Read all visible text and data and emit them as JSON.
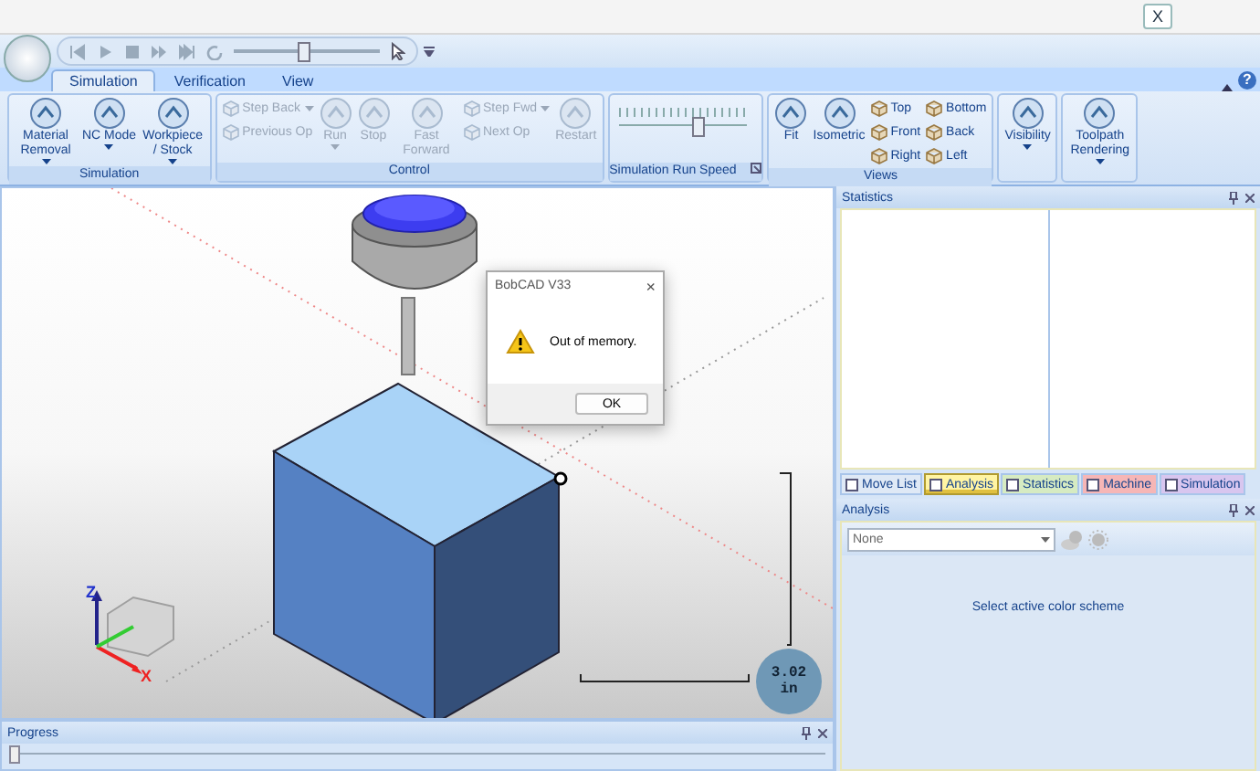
{
  "close_button": "X",
  "quick_access": {
    "speed": {
      "level": 0.48
    }
  },
  "ribbon": {
    "help_button": "?",
    "tabs": [
      {
        "label": "Simulation",
        "selected": true
      },
      {
        "label": "Verification",
        "selected": false
      },
      {
        "label": "View",
        "selected": false
      }
    ],
    "groups": [
      {
        "title": "Simulation",
        "items": [
          {
            "label": "Material Removal",
            "kind": "large",
            "dropdown": true,
            "disabled": false
          },
          {
            "label": "NC Mode",
            "kind": "large",
            "dropdown": true,
            "disabled": false
          },
          {
            "label": "Workpiece / Stock",
            "kind": "large",
            "dropdown": true,
            "disabled": false
          }
        ]
      },
      {
        "title": "Control",
        "items": [
          {
            "label": "Step Back",
            "kind": "small",
            "dropdown": true,
            "disabled": true
          },
          {
            "label": "Previous Op",
            "kind": "small",
            "dropdown": false,
            "disabled": true
          },
          {
            "label": "Run",
            "kind": "large",
            "dropdown": true,
            "disabled": true
          },
          {
            "label": "Stop",
            "kind": "large",
            "dropdown": false,
            "disabled": true
          },
          {
            "label": "Fast Forward",
            "kind": "large",
            "dropdown": false,
            "disabled": true
          },
          {
            "label": "Step Fwd",
            "kind": "small",
            "dropdown": true,
            "disabled": true
          },
          {
            "label": "Next Op",
            "kind": "small",
            "dropdown": false,
            "disabled": true
          },
          {
            "label": "Restart",
            "kind": "large",
            "dropdown": false,
            "disabled": true
          }
        ]
      },
      {
        "title": "Simulation Run Speed",
        "items": [
          {
            "kind": "slider",
            "level": 0.62
          }
        ]
      },
      {
        "title": "Views",
        "items": [
          {
            "label": "Fit",
            "kind": "large",
            "dropdown": false,
            "disabled": false
          },
          {
            "label": "Isometric",
            "kind": "large",
            "dropdown": false,
            "disabled": false
          },
          {
            "label": "Top",
            "kind": "small",
            "dropdown": false,
            "disabled": false
          },
          {
            "label": "Front",
            "kind": "small",
            "dropdown": false,
            "disabled": false
          },
          {
            "label": "Right",
            "kind": "small",
            "dropdown": false,
            "disabled": false
          },
          {
            "label": "Bottom",
            "kind": "small",
            "dropdown": false,
            "disabled": false
          },
          {
            "label": "Back",
            "kind": "small",
            "dropdown": false,
            "disabled": false
          },
          {
            "label": "Left",
            "kind": "small",
            "dropdown": false,
            "disabled": false
          }
        ]
      },
      {
        "items": [
          {
            "label": "Visibility",
            "kind": "large",
            "dropdown": true,
            "disabled": false
          }
        ]
      },
      {
        "items": [
          {
            "label": "Toolpath Rendering",
            "kind": "large",
            "dropdown": true,
            "disabled": false
          }
        ]
      }
    ]
  },
  "viewport": {
    "axes": {
      "z": "Z",
      "x": "X"
    },
    "scale": {
      "value": "3.02",
      "unit": "in"
    },
    "dialog": {
      "title": "BobCAD V33",
      "close": "×",
      "message": "Out of memory.",
      "button": "OK"
    }
  },
  "progress": {
    "title": "Progress",
    "level": 0
  },
  "statistics": {
    "title": "Statistics"
  },
  "dock_tabs": [
    {
      "label": "Move List",
      "color": "#dfe9f6",
      "selected": false
    },
    {
      "label": "Analysis",
      "color": "#fff4a3",
      "selected": true
    },
    {
      "label": "Statistics",
      "color": "#d6ebc2",
      "selected": false
    },
    {
      "label": "Machine",
      "color": "#f6b6b6",
      "selected": false
    },
    {
      "label": "Simulation",
      "color": "#d8c6ef",
      "selected": false
    }
  ],
  "analysis": {
    "title": "Analysis",
    "scheme": "None",
    "message": "Select active color scheme"
  }
}
